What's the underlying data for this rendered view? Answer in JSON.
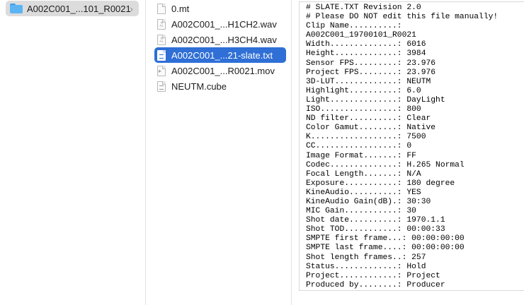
{
  "column1": {
    "items": [
      {
        "label": "A002C001_...101_R0021",
        "icon": "folder-icon",
        "selected": true
      }
    ],
    "chevron": "›"
  },
  "column2": {
    "items": [
      {
        "label": "0.mt",
        "icon": "document-icon"
      },
      {
        "label": "A002C001_...H1CH2.wav",
        "icon": "audio-file-icon"
      },
      {
        "label": "A002C001_...H3CH4.wav",
        "icon": "audio-file-icon"
      },
      {
        "label": "A002C001_...21-slate.txt",
        "icon": "text-file-icon",
        "selected": true
      },
      {
        "label": "A002C001_...R0021.mov",
        "icon": "video-file-icon"
      },
      {
        "label": "NEUTM.cube",
        "icon": "text-file-icon"
      }
    ]
  },
  "preview": {
    "lines": [
      "# SLATE.TXT Revision 2.0",
      "# Please DO NOT edit this file manually!",
      "Clip Name..........:",
      "A002C001_19700101_R0021",
      "Width..............: 6016",
      "Height.............: 3984",
      "Sensor FPS.........: 23.976",
      "Project FPS........: 23.976",
      "3D-LUT.............: NEUTM",
      "Highlight..........: 6.0",
      "Light..............: DayLight",
      "ISO................: 800",
      "ND filter..........: Clear",
      "Color Gamut........: Native",
      "K..................: 7500",
      "CC.................: 0",
      "Image Format.......: FF",
      "Codec..............: H.265 Normal",
      "Focal Length.......: N/A",
      "Exposure...........: 180 degree",
      "KineAudio..........: YES",
      "KineAudio Gain(dB).: 30:30",
      "MIC Gain...........: 30",
      "Shot date..........: 1970.1.1",
      "Shot TOD...........: 00:00:33",
      "SMPTE first frame...: 00:00:00:00",
      "SMPTE last frame....: 00:00:00:00",
      "Shot length frames..: 257",
      "Status.............: Hold",
      "Project............: Project",
      "Produced by........: Producer"
    ]
  },
  "colors": {
    "selection_active": "#2f6fd6",
    "selection_inactive": "#dcdcdc",
    "folder": "#5db4f3"
  }
}
